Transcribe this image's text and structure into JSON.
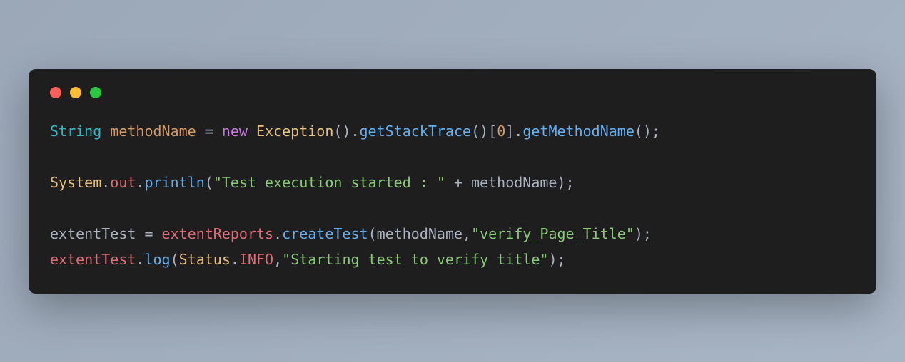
{
  "window": {
    "traffic_lights": {
      "red": "#ff5f56",
      "yellow": "#ffbd2e",
      "green": "#27c93f"
    }
  },
  "code": {
    "line1": {
      "type": "String",
      "var": "methodName",
      "eq": " = ",
      "new": "new",
      "sp1": " ",
      "class": "Exception",
      "call1": "().",
      "m1": "getStackTrace",
      "br1": "()[",
      "idx": "0",
      "br2": "].",
      "m2": "getMethodName",
      "end": "();"
    },
    "blank1": "",
    "line2": {
      "sys": "System",
      "dot1": ".",
      "out": "out",
      "dot2": ".",
      "println": "println",
      "open": "(",
      "str": "\"Test execution started : \"",
      "plus": " + ",
      "var": "methodName",
      "close": ");"
    },
    "blank2": "",
    "line3": {
      "lhs": "extentTest",
      "eq": " = ",
      "rhs": "extentReports",
      "dot": ".",
      "m": "createTest",
      "open": "(",
      "arg1": "methodName",
      "comma": ",",
      "str": "\"verify_Page_Title\"",
      "close": ");"
    },
    "line4": {
      "obj": "extentTest",
      "dot1": ".",
      "m": "log",
      "open": "(",
      "status": "Status",
      "dot2": ".",
      "info": "INFO",
      "comma": ",",
      "str": "\"Starting test to verify title\"",
      "close": ");"
    }
  }
}
